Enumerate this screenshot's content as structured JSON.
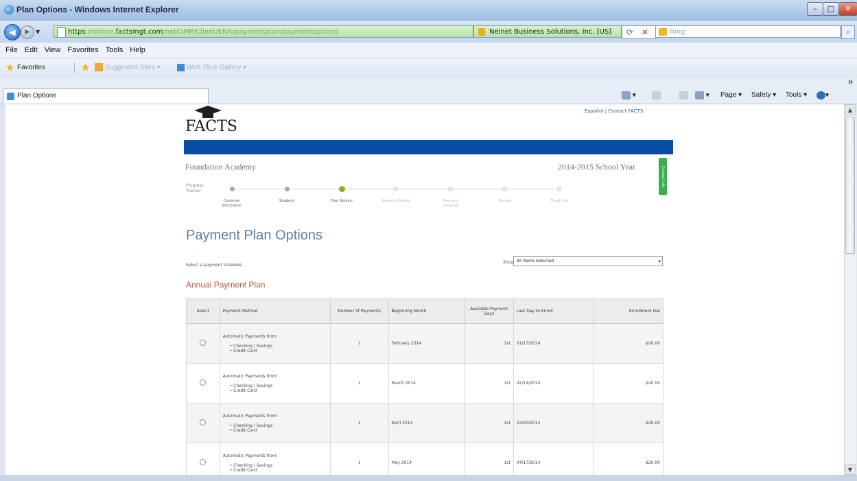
{
  "window": {
    "title": "Plan Options - Windows Internet Explorer",
    "min": "–",
    "max": "□",
    "close": "✕"
  },
  "address": {
    "url_scheme": "https",
    "url_host": "factsmgt.com",
    "cert_text": "Nelnet Business Solutions, Inc. [US]",
    "search_placeholder": "Bing"
  },
  "menu": [
    "File",
    "Edit",
    "View",
    "Favorites",
    "Tools",
    "Help"
  ],
  "favorites_bar": {
    "favorites": "Favorites",
    "suggested": "Suggested Sites ▾",
    "gallery": "Web Slice Gallery ▾"
  },
  "tab": {
    "label": "Plan Options"
  },
  "commandbar": {
    "page": "Page ▾",
    "safety": "Safety ▾",
    "tools": "Tools ▾",
    "help": "▾",
    "more": "»"
  },
  "page": {
    "logo": "FACTS",
    "top_links": "Español | Contact FACTS",
    "academy": "Foundation Academy",
    "school_year": "2014-2015 School Year",
    "green_tab": "Contact Info",
    "tracker_label": "Progress Tracker",
    "steps": [
      "Customer Information",
      "Students",
      "Plan Options",
      "Payment Details",
      "Payment Schedule",
      "Review",
      "Thank You"
    ],
    "current_step": 2,
    "heading": "Payment Plan Options",
    "select_schedule": "Select a payment schedule",
    "show_label": "Show:",
    "show_value": "All Items Selected",
    "section_title": "Annual Payment Plan",
    "columns": [
      "Select",
      "Payment Method",
      "Number of Payments",
      "Beginning Month",
      "Available Payment Days",
      "Last Day to Enroll",
      "Enrollment Fee"
    ],
    "method_head": "Automatic Payments from:",
    "method_items": [
      "• Checking / Savings",
      "• Credit Card"
    ],
    "rows": [
      {
        "payments": "1",
        "month": "February 2014",
        "days": "1st",
        "last_day": "01/17/2014",
        "fee": "$20.00"
      },
      {
        "payments": "1",
        "month": "March 2014",
        "days": "1st",
        "last_day": "02/14/2014",
        "fee": "$20.00"
      },
      {
        "payments": "1",
        "month": "April 2014",
        "days": "1st",
        "last_day": "03/20/2014",
        "fee": "$20.00"
      },
      {
        "payments": "1",
        "month": "May 2014",
        "days": "1st",
        "last_day": "04/17/2014",
        "fee": "$20.00"
      }
    ]
  }
}
